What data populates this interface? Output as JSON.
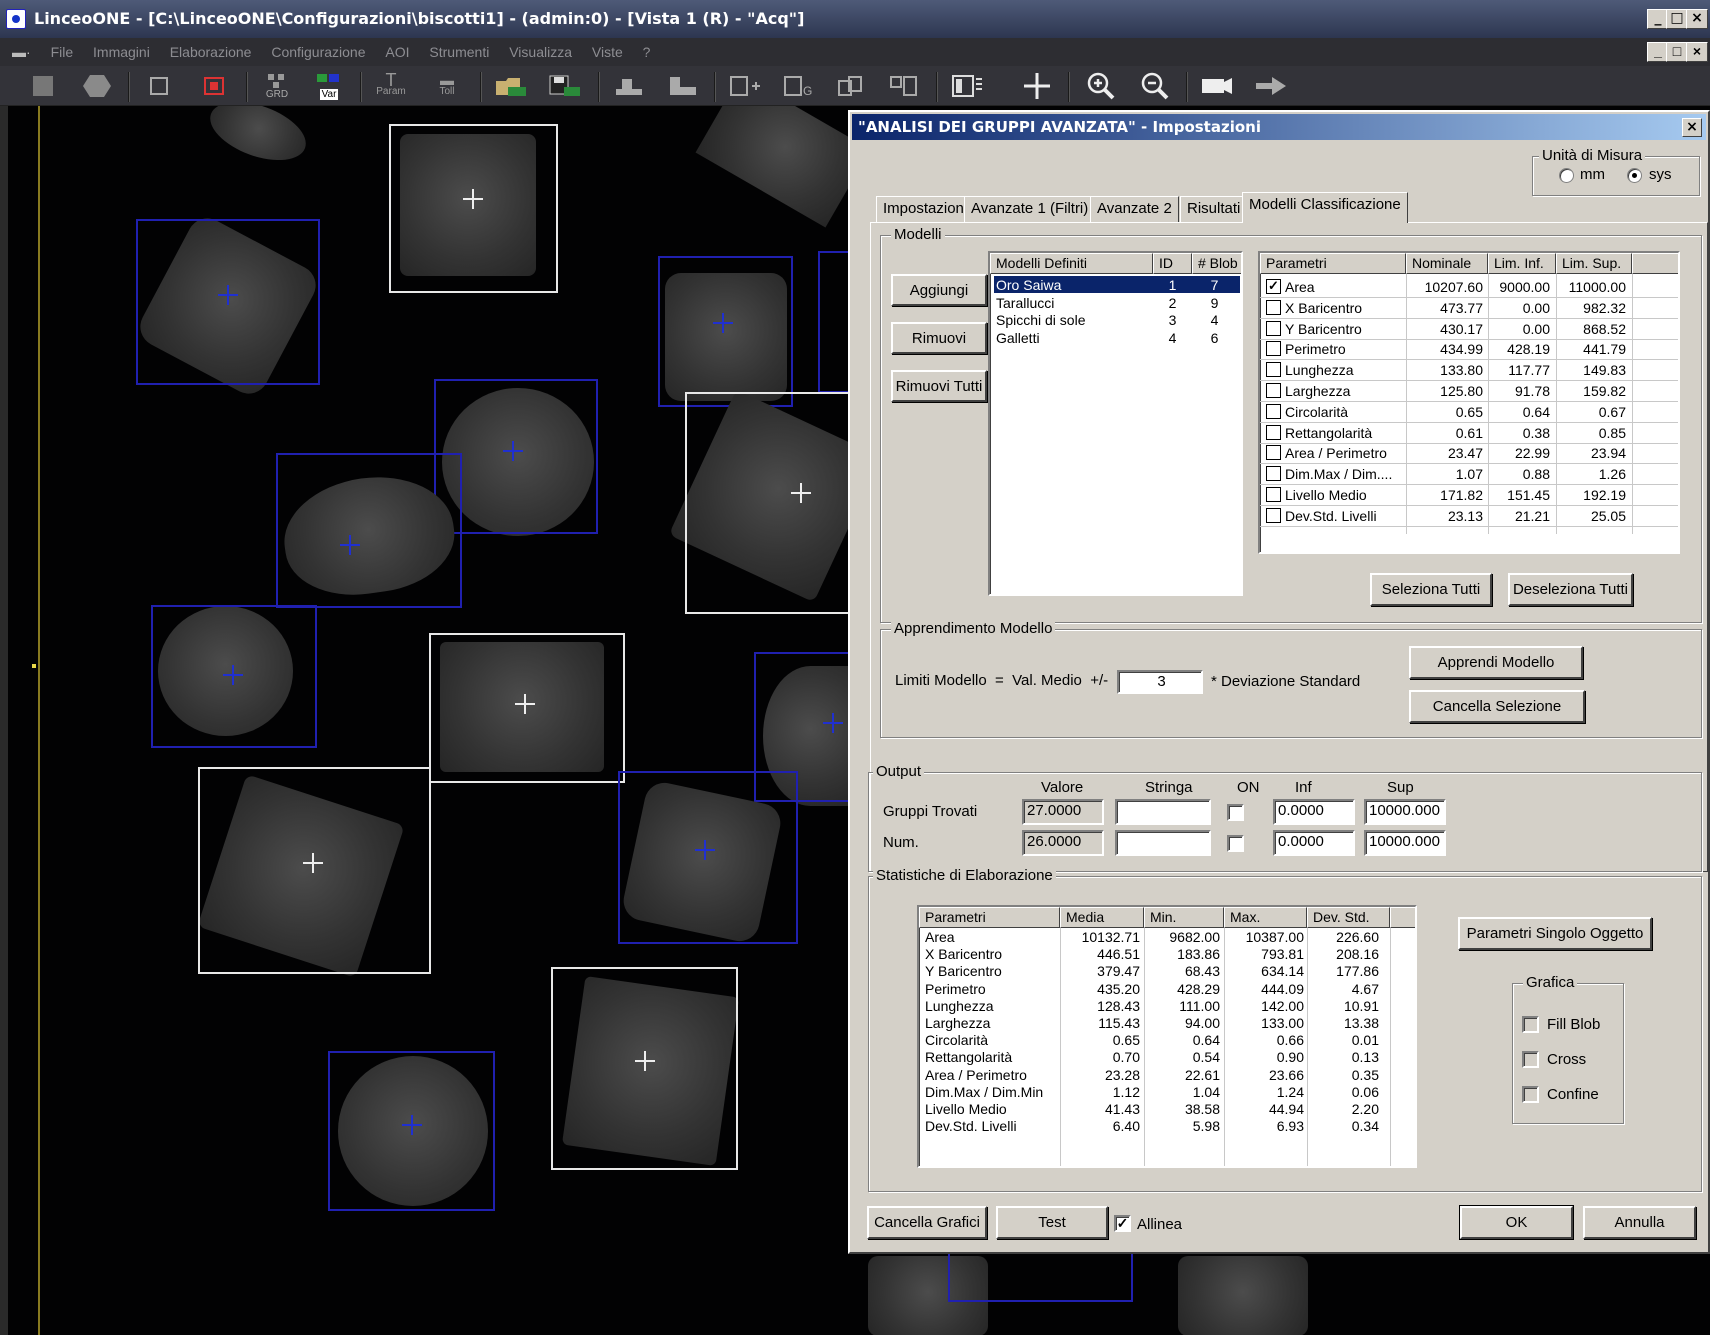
{
  "window": {
    "title": "LinceoONE - [C:\\LinceoONE\\Configurazioni\\biscotti1] - (admin:0) - [Vista 1 (R) - \"Acq\"]",
    "controls": [
      "_",
      "□",
      "×"
    ]
  },
  "menu": [
    "File",
    "Immagini",
    "Elaborazione",
    "Configurazione",
    "AOI",
    "Strumenti",
    "Visualizza",
    "Viste",
    "?"
  ],
  "toolbar": {
    "grd": "GRD",
    "var": "Var",
    "param": "Param",
    "toll": "Toll"
  },
  "dialog": {
    "title": "\"ANALISI DEI GRUPPI AVANZATA\" - Impostazioni",
    "close": "×",
    "units": {
      "label": "Unità di Misura",
      "mm": "mm",
      "sys": "sys",
      "selected": "sys"
    },
    "tabs": [
      "Impostazioni",
      "Avanzate 1 (Filtri)",
      "Avanzate 2",
      "Risultati",
      "Modelli Classificazione"
    ],
    "active_tab": "Modelli Classificazione",
    "modelli": {
      "label": "Modelli",
      "btn_add": "Aggiungi",
      "btn_remove": "Rimuovi",
      "btn_remove_all": "Rimuovi Tutti",
      "list_headers": [
        "Modelli Definiti",
        "ID",
        "# Blob"
      ],
      "models": [
        {
          "name": "Oro Saiwa",
          "id": "1",
          "blob": "7"
        },
        {
          "name": "Tarallucci",
          "id": "2",
          "blob": "9"
        },
        {
          "name": "Spicchi di sole",
          "id": "3",
          "blob": "4"
        },
        {
          "name": "Galletti",
          "id": "4",
          "blob": "6"
        }
      ],
      "param_headers": [
        "Parametri",
        "Nominale",
        "Lim. Inf.",
        "Lim. Sup."
      ],
      "params": [
        {
          "name": "Area",
          "checked": true,
          "nom": "10207.60",
          "inf": "9000.00",
          "sup": "11000.00"
        },
        {
          "name": "X Baricentro",
          "checked": false,
          "nom": "473.77",
          "inf": "0.00",
          "sup": "982.32"
        },
        {
          "name": "Y Baricentro",
          "checked": false,
          "nom": "430.17",
          "inf": "0.00",
          "sup": "868.52"
        },
        {
          "name": "Perimetro",
          "checked": false,
          "nom": "434.99",
          "inf": "428.19",
          "sup": "441.79"
        },
        {
          "name": "Lunghezza",
          "checked": false,
          "nom": "133.80",
          "inf": "117.77",
          "sup": "149.83"
        },
        {
          "name": "Larghezza",
          "checked": false,
          "nom": "125.80",
          "inf": "91.78",
          "sup": "159.82"
        },
        {
          "name": "Circolarità",
          "checked": false,
          "nom": "0.65",
          "inf": "0.64",
          "sup": "0.67"
        },
        {
          "name": "Rettangolarità",
          "checked": false,
          "nom": "0.61",
          "inf": "0.38",
          "sup": "0.85"
        },
        {
          "name": "Area / Perimetro",
          "checked": false,
          "nom": "23.47",
          "inf": "22.99",
          "sup": "23.94"
        },
        {
          "name": "Dim.Max / Dim....",
          "checked": false,
          "nom": "1.07",
          "inf": "0.88",
          "sup": "1.26"
        },
        {
          "name": "Livello Medio",
          "checked": false,
          "nom": "171.82",
          "inf": "151.45",
          "sup": "192.19"
        },
        {
          "name": "Dev.Std. Livelli",
          "checked": false,
          "nom": "23.13",
          "inf": "21.21",
          "sup": "25.05"
        }
      ],
      "btn_select_all": "Seleziona Tutti",
      "btn_deselect_all": "Deseleziona Tutti"
    },
    "apprendimento": {
      "label": "Apprendimento Modello",
      "limits_label": "Limiti Modello  =  Val. Medio  +/-",
      "value": "3",
      "suffix": "* Deviazione Standard",
      "btn_learn": "Apprendi Modello",
      "btn_clear": "Cancella Selezione"
    },
    "output": {
      "label": "Output",
      "headers": [
        "Valore",
        "Stringa",
        "ON",
        "Inf",
        "Sup"
      ],
      "rows": [
        {
          "name": "Gruppi Trovati",
          "valore": "27.0000",
          "stringa": "",
          "inf": "0.0000",
          "sup": "10000.000"
        },
        {
          "name": "Num.",
          "valore": "26.0000",
          "stringa": "",
          "inf": "0.0000",
          "sup": "10000.000"
        }
      ]
    },
    "statistiche": {
      "label": "Statistiche di Elaborazione",
      "headers": [
        "Parametri",
        "Media",
        "Min.",
        "Max.",
        "Dev. Std."
      ],
      "rows": [
        [
          "Area",
          "10132.71",
          "9682.00",
          "10387.00",
          "226.60"
        ],
        [
          "X Baricentro",
          "446.51",
          "183.86",
          "793.81",
          "208.16"
        ],
        [
          "Y Baricentro",
          "379.47",
          "68.43",
          "634.14",
          "177.86"
        ],
        [
          "Perimetro",
          "435.20",
          "428.29",
          "444.09",
          "4.67"
        ],
        [
          "Lunghezza",
          "128.43",
          "111.00",
          "142.00",
          "10.91"
        ],
        [
          "Larghezza",
          "115.43",
          "94.00",
          "133.00",
          "13.38"
        ],
        [
          "Circolarità",
          "0.65",
          "0.64",
          "0.66",
          "0.01"
        ],
        [
          "Rettangolarità",
          "0.70",
          "0.54",
          "0.90",
          "0.13"
        ],
        [
          "Area / Perimetro",
          "23.28",
          "22.61",
          "23.66",
          "0.35"
        ],
        [
          "Dim.Max / Dim.Min",
          "1.12",
          "1.04",
          "1.24",
          "0.06"
        ],
        [
          "Livello Medio",
          "41.43",
          "38.58",
          "44.94",
          "2.20"
        ],
        [
          "Dev.Std. Livelli",
          "6.40",
          "5.98",
          "6.93",
          "0.34"
        ]
      ],
      "btn_single": "Parametri Singolo Oggetto",
      "grafica": {
        "label": "Grafica",
        "fill_blob": "Fill Blob",
        "cross": "Cross",
        "confine": "Confine"
      }
    },
    "footer": {
      "btn_clear_graphics": "Cancella Grafici",
      "btn_test": "Test",
      "allinea": "Allinea",
      "btn_ok": "OK",
      "btn_cancel": "Annulla"
    }
  }
}
